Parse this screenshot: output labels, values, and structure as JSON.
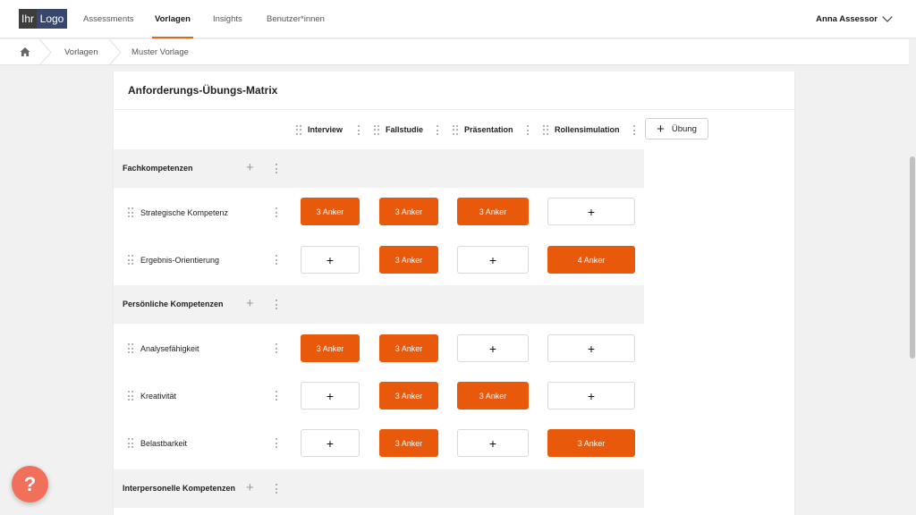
{
  "logo": {
    "part1": "Ihr",
    "part2": "Logo"
  },
  "nav": {
    "items": [
      "Assessments",
      "Vorlagen",
      "Insights",
      "Benutzer*innen"
    ],
    "active": "Vorlagen"
  },
  "user": {
    "name": "Anna Assessor"
  },
  "breadcrumb": {
    "items": [
      "Vorlagen",
      "Muster Vorlage"
    ]
  },
  "matrix": {
    "title": "Anforderungs-Übungs-Matrix",
    "add_exercise_label": "Übung",
    "exercises": [
      "Interview",
      "Fallstudie",
      "Präsentation",
      "Rollensimulation"
    ],
    "groups": [
      {
        "name": "Fachkompetenzen",
        "competencies": [
          {
            "name": "Strategische Kompetenz",
            "cells": [
              "3 Anker",
              "3 Anker",
              "3 Anker",
              "+"
            ]
          },
          {
            "name": "Ergebnis-Orientierung",
            "cells": [
              "+",
              "3 Anker",
              "+",
              "4 Anker"
            ]
          }
        ]
      },
      {
        "name": "Persönliche Kompetenzen",
        "competencies": [
          {
            "name": "Analysefähigkeit",
            "cells": [
              "3 Anker",
              "3 Anker",
              "+",
              "+"
            ]
          },
          {
            "name": "Kreativität",
            "cells": [
              "+",
              "3 Anker",
              "3 Anker",
              "+"
            ]
          },
          {
            "name": "Belastbarkeit",
            "cells": [
              "+",
              "3 Anker",
              "+",
              "3 Anker"
            ]
          }
        ]
      },
      {
        "name": "Interpersonelle Kompetenzen",
        "competencies": []
      }
    ]
  },
  "help": {
    "label": "?"
  },
  "colors": {
    "accent": "#e8590c",
    "help_button": "#f0705a"
  }
}
